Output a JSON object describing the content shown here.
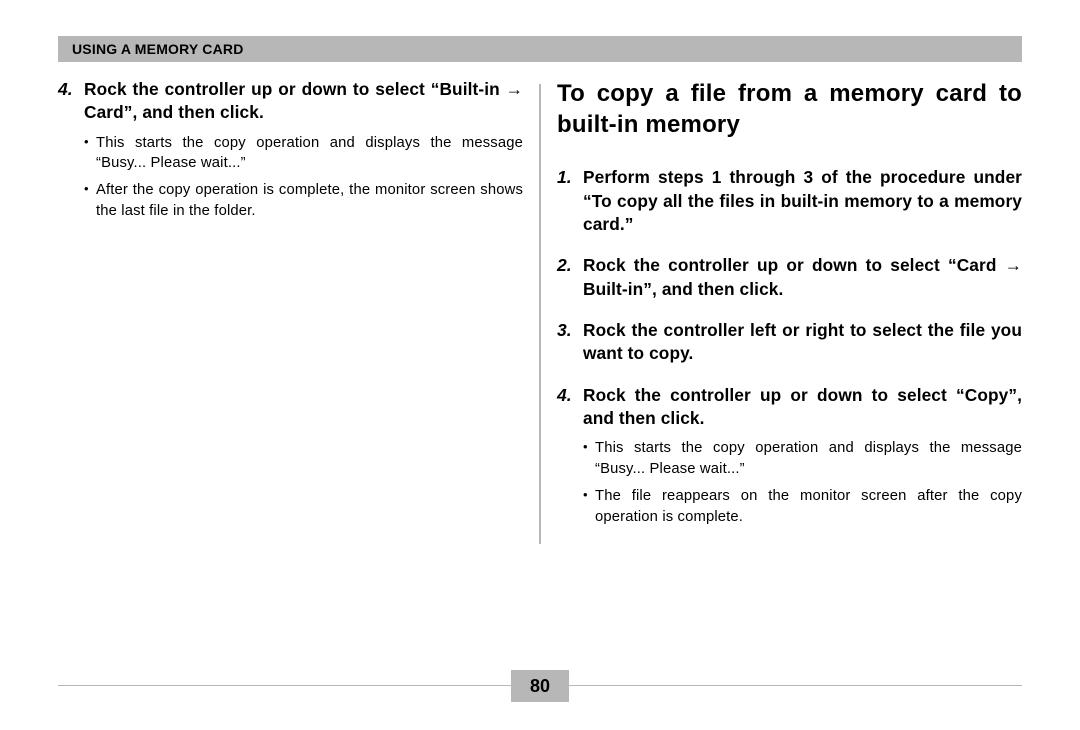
{
  "header": {
    "title": "USING A MEMORY CARD"
  },
  "left": {
    "step4": {
      "num": "4.",
      "text": "Rock the controller up or down to select “Built-in → Card”, and then click.",
      "bullets": [
        "This starts the copy operation and displays the message “Busy... Please wait...”",
        "After the copy operation is complete, the monitor screen shows the last file in the folder."
      ]
    }
  },
  "right": {
    "title": "To copy a file from a memory card to built-in memory",
    "step1": {
      "num": "1.",
      "text": "Perform steps 1 through 3 of the procedure under “To copy all the files in built-in memory to a memory card.”"
    },
    "step2": {
      "num": "2.",
      "text": "Rock the controller up or down to select “Card → Built-in”, and then click."
    },
    "step3": {
      "num": "3.",
      "text": "Rock the controller left or right to select the file you want to copy."
    },
    "step4": {
      "num": "4.",
      "text": "Rock the controller up or down to select “Copy”, and then click.",
      "bullets": [
        "This starts the copy operation and displays the message “Busy... Please wait...”",
        "The file reappears on the monitor screen after the copy operation is complete."
      ]
    }
  },
  "pageNumber": "80"
}
